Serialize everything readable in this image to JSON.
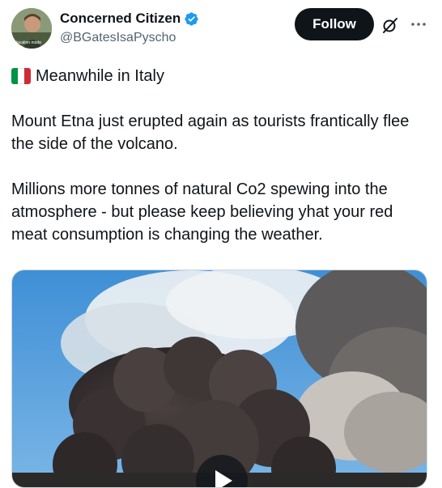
{
  "author": {
    "display_name": "Concerned Citizen",
    "handle": "@BGatesIsaPyscho",
    "verified_icon": "verified-badge-icon",
    "avatar_caption": "Vacation mode"
  },
  "actions": {
    "follow_label": "Follow",
    "grok_icon": "grok-slash-icon",
    "more_icon": "more-horizontal-icon"
  },
  "tweet": {
    "country_flag": "italy-flag-icon",
    "line1": "Meanwhile in Italy",
    "para1": "Mount Etna just erupted again as tourists frantically flee the side of the volcano.",
    "para2": "Millions more tonnes of natural Co2 spewing into the atmosphere - but please keep believing yhat your red meat consumption is changing the weather."
  },
  "media": {
    "type": "video",
    "play_icon": "play-icon"
  },
  "colors": {
    "follow_bg": "#0f1419",
    "verified": "#1d9bf0",
    "secondary_text": "#536471",
    "flag_green": "#009246",
    "flag_white": "#ffffff",
    "flag_red": "#ce2b37"
  }
}
